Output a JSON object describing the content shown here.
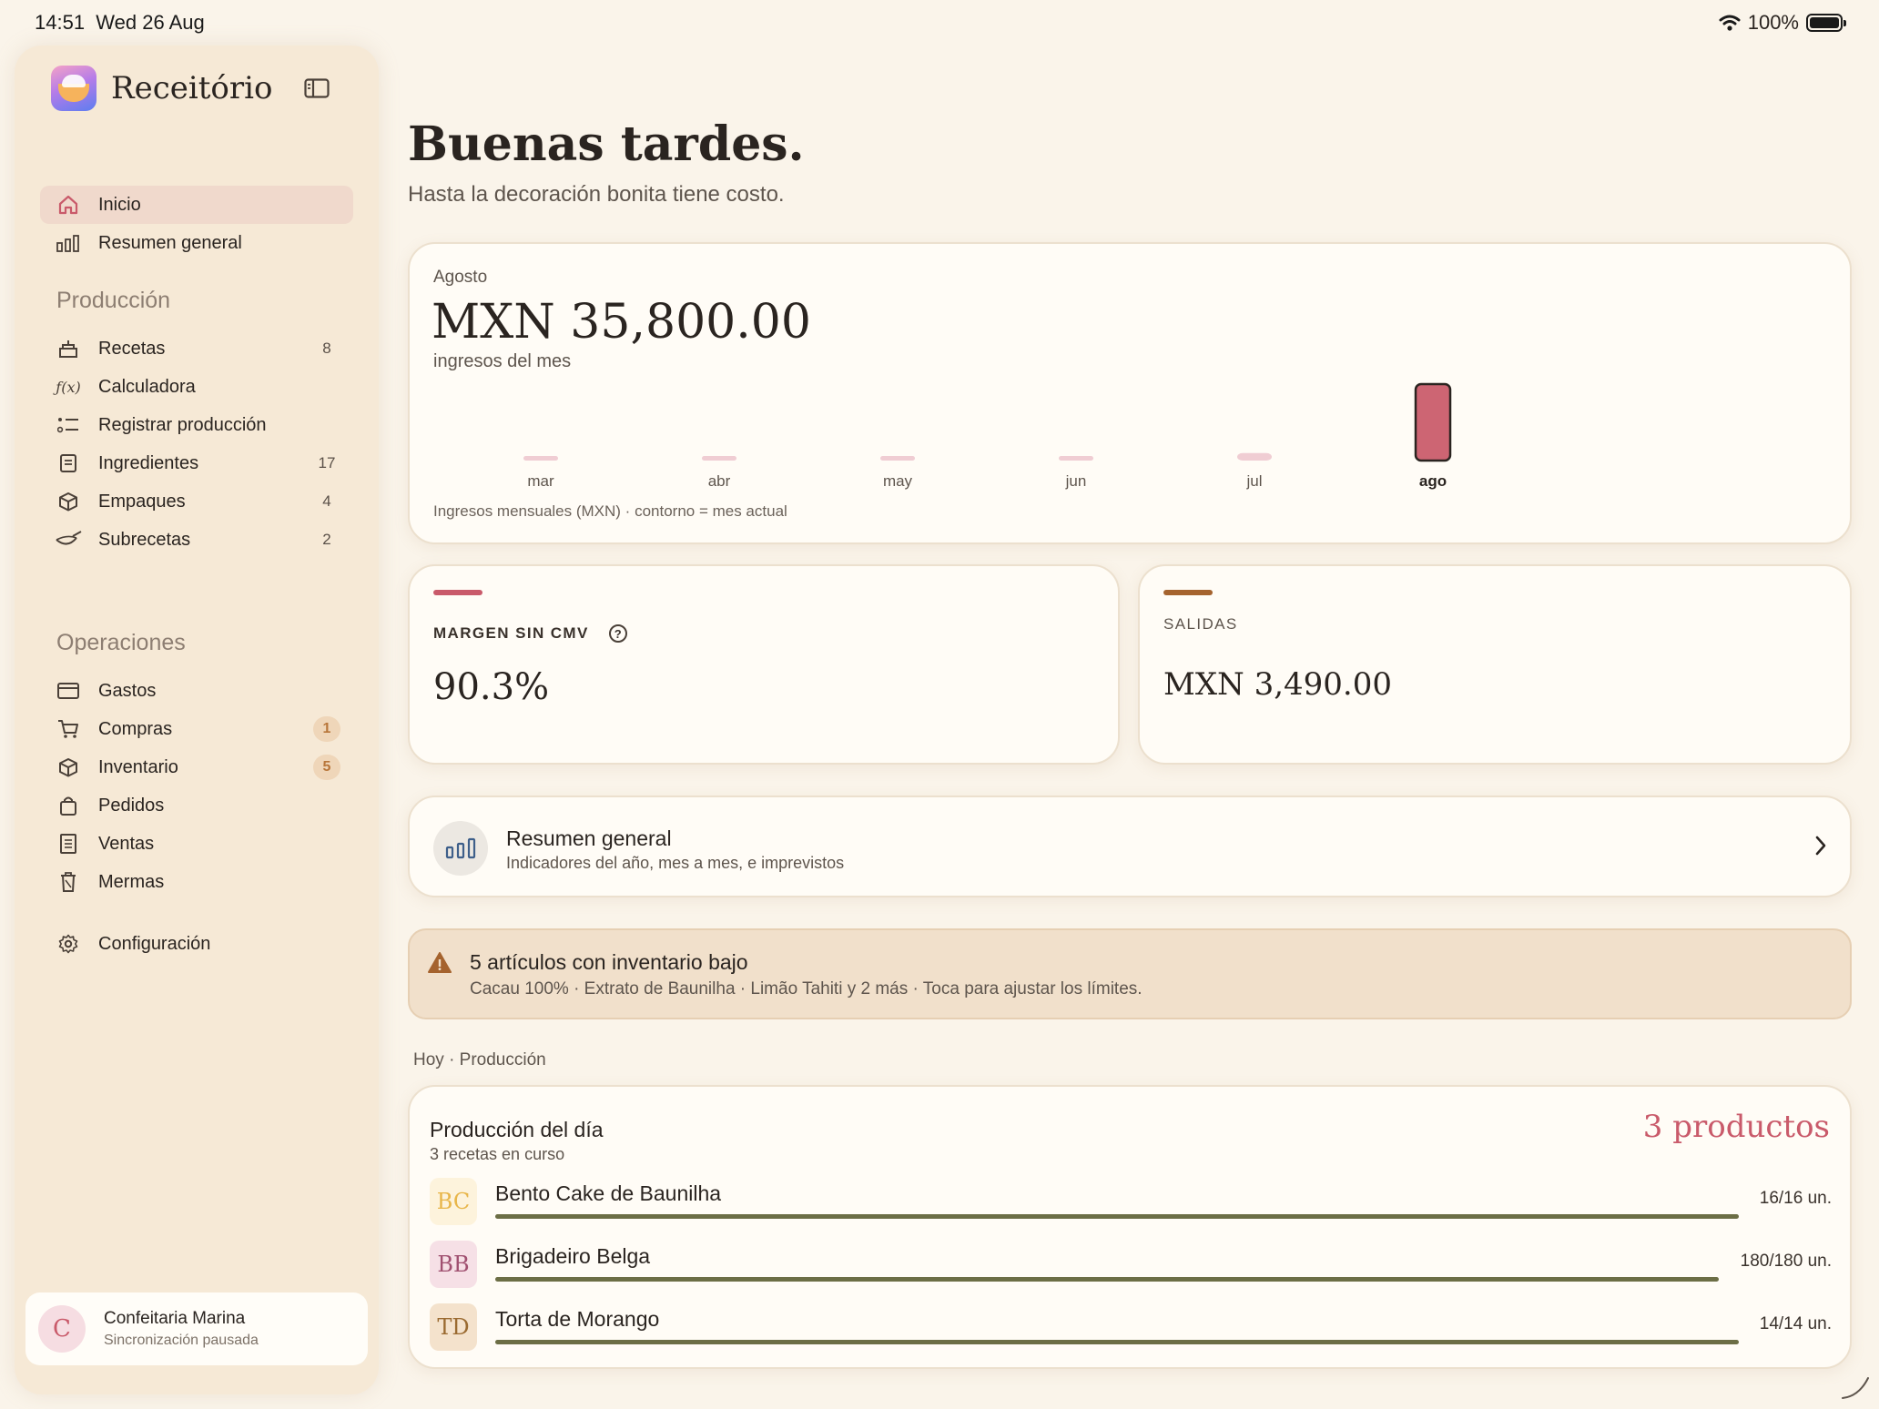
{
  "status_bar": {
    "time": "14:51",
    "date": "Wed 26 Aug",
    "battery": "100%"
  },
  "sidebar": {
    "app_name": "Receitório",
    "primary": [
      {
        "label": "Inicio",
        "icon": "home-icon",
        "active": true
      },
      {
        "label": "Resumen general",
        "icon": "bar-chart-icon"
      }
    ],
    "production_title": "Producción",
    "production": [
      {
        "label": "Recetas",
        "icon": "cake-icon",
        "count": "8"
      },
      {
        "label": "Calculadora",
        "icon": "function-icon"
      },
      {
        "label": "Registrar producción",
        "icon": "checklist-icon"
      },
      {
        "label": "Ingredientes",
        "icon": "list-clipboard-icon",
        "count": "17"
      },
      {
        "label": "Empaques",
        "icon": "box-icon",
        "count": "4"
      },
      {
        "label": "Subrecetas",
        "icon": "whisk-icon",
        "count": "2"
      }
    ],
    "operations_title": "Operaciones",
    "operations": [
      {
        "label": "Gastos",
        "icon": "credit-card-icon"
      },
      {
        "label": "Compras",
        "icon": "cart-icon",
        "badge": "1"
      },
      {
        "label": "Inventario",
        "icon": "cube-icon",
        "badge": "5"
      },
      {
        "label": "Pedidos",
        "icon": "bag-icon"
      },
      {
        "label": "Ventas",
        "icon": "receipt-icon"
      },
      {
        "label": "Mermas",
        "icon": "trash-icon"
      }
    ],
    "settings": {
      "label": "Configuración",
      "icon": "gear-icon"
    },
    "account": {
      "initial": "C",
      "name": "Confeitaria Marina",
      "status": "Sincronización pausada"
    }
  },
  "main": {
    "greeting": "Buenas tardes.",
    "subtitle": "Hasta la decoración bonita tiene costo.",
    "revenue": {
      "month": "Agosto",
      "amount": "MXN 35,800.00",
      "caption": "ingresos del mes",
      "footnote": "Ingresos mensuales (MXN) · contorno = mes actual"
    },
    "margin": {
      "label": "MARGEN SIN CMV",
      "value": "90.3%",
      "accent": "#c95a6a"
    },
    "outflow": {
      "label": "SALIDAS",
      "value": "MXN 3,490.00",
      "accent": "#a5632e"
    },
    "overview": {
      "title": "Resumen general",
      "subtitle": "Indicadores del año, mes a mes, e imprevistos"
    },
    "alert": {
      "title": "5 artículos con inventario bajo",
      "detail": "Cacau 100% · Extrato de Baunilha · Limão Tahiti y 2 más · Toca para ajustar los límites."
    },
    "section_header": "Hoy · Producción",
    "production": {
      "title": "Producción del día",
      "subtitle": "3 recetas en curso",
      "count": "3 productos",
      "items": [
        {
          "initials": "BC",
          "name": "Bento Cake de Baunilha",
          "qty": "16/16 un.",
          "progress": 1.0,
          "bg": "#fdf3dc",
          "fg": "#e8b64a"
        },
        {
          "initials": "BB",
          "name": "Brigadeiro Belga",
          "qty": "180/180 un.",
          "progress": 1.0,
          "bg": "#f6e0e6",
          "fg": "#a05070"
        },
        {
          "initials": "TD",
          "name": "Torta de Morango",
          "qty": "14/14 un.",
          "progress": 1.0,
          "bg": "#f4e2cc",
          "fg": "#9a6a30"
        }
      ]
    }
  },
  "chart_data": {
    "type": "bar",
    "categories": [
      "mar",
      "abr",
      "may",
      "jun",
      "jul",
      "ago"
    ],
    "values": [
      0,
      0,
      0,
      0,
      3500,
      35800
    ],
    "highlight": "ago",
    "colors": {
      "bar": "#f0cdd3",
      "current": "#cd6573",
      "outline": "#2a2420"
    }
  }
}
